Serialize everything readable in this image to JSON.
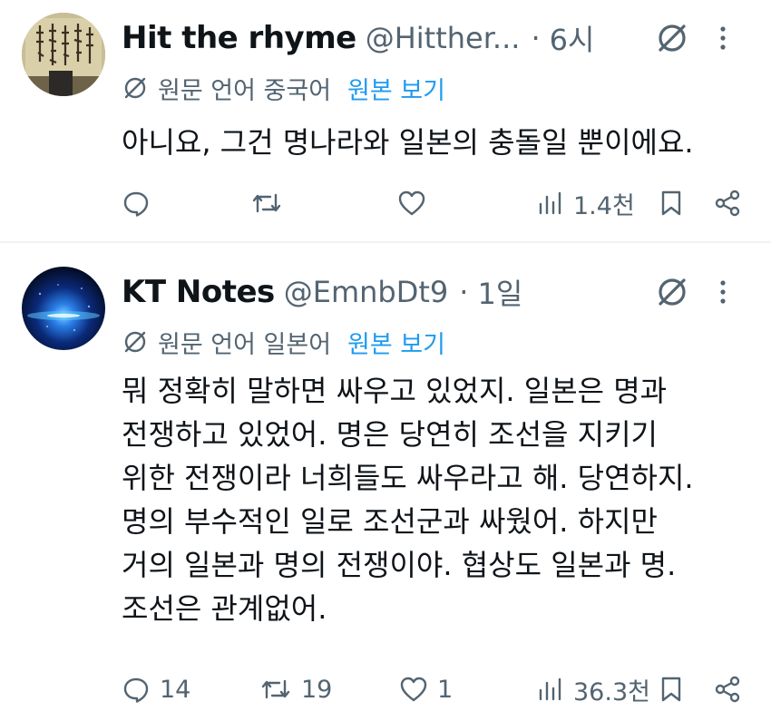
{
  "tweets": [
    {
      "display_name": "Hit the rhyme",
      "handle": "@Hitther...",
      "separator": "·",
      "time": "6시",
      "avatar_icon": "calligraphy-avatar",
      "translate": {
        "label": "원문 언어 중국어",
        "show_original": "원본 보기"
      },
      "lines": [
        "아니요, 그건 명나라와 일본의 충돌일 뿐이에요."
      ],
      "actions": {
        "replies": "",
        "reposts": "",
        "likes": "",
        "views": "1.4천"
      }
    },
    {
      "display_name": "KT Notes",
      "handle": "@EmnbDt9",
      "separator": "·",
      "time": "1일",
      "avatar_icon": "blue-galaxy-avatar",
      "translate": {
        "label": "원문 언어 일본어",
        "show_original": "원본 보기"
      },
      "lines": [
        "뭐 정확히 말하면 싸우고 있었지. 일본은 명과",
        "전쟁하고 있었어. 명은 당연히 조선을 지키기",
        "위한 전쟁이라 너희들도 싸우라고 해. 당연하지.",
        "명의 부수적인 일로 조선군과 싸웠어. 하지만",
        "거의 일본과 명의 전쟁이야. 협상도 일본과 명.",
        "조선은 관계없어."
      ],
      "actions": {
        "replies": "14",
        "reposts": "19",
        "likes": "1",
        "views": "36.3천"
      }
    }
  ],
  "colors": {
    "text": "#0f1419",
    "muted": "#536471",
    "accent": "#1d9bf0",
    "divider": "#eff3f4"
  }
}
